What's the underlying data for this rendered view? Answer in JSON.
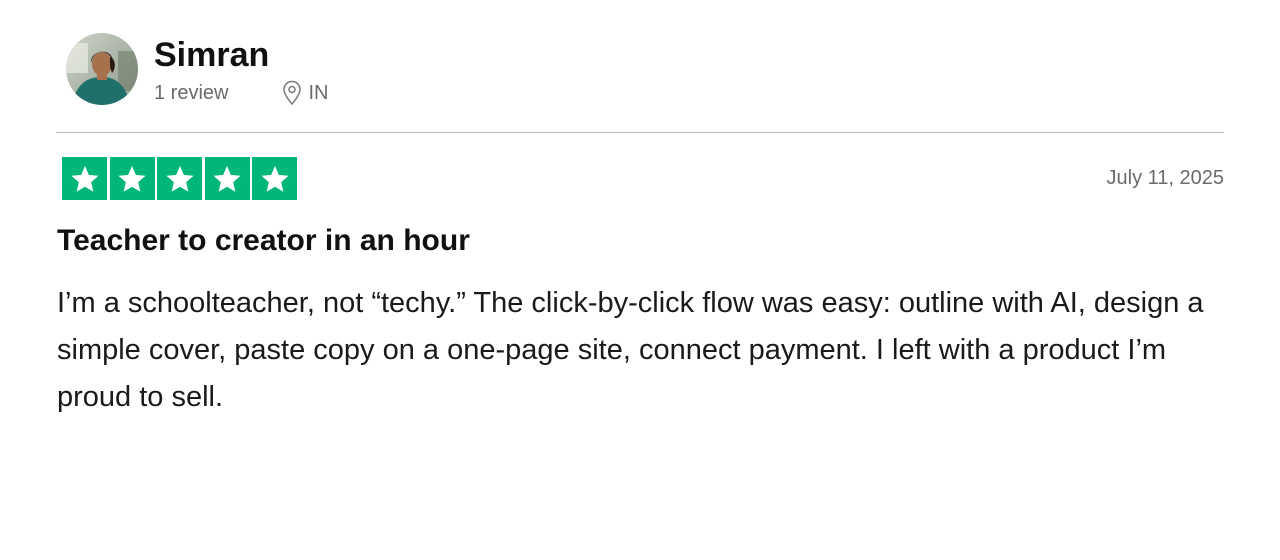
{
  "reviewer": {
    "name": "Simran",
    "review_count": "1 review",
    "location": "IN",
    "location_icon": "map-pin-icon",
    "avatar": "profile photo"
  },
  "rating": {
    "stars": 5,
    "max": 5,
    "star_color": "#00b67a"
  },
  "review": {
    "date": "July 11, 2025",
    "title": "Teacher to creator in an hour",
    "body": "I’m a schoolteacher, not “techy.” The click-by-click flow was easy: outline with AI, design a simple cover, paste copy on a one-page site, connect payment. I left with a product I’m proud to sell."
  },
  "colors": {
    "text_primary": "#111111",
    "text_secondary": "#6b6b6b",
    "divider": "#bdbdbd",
    "star_fill": "#00b67a"
  }
}
